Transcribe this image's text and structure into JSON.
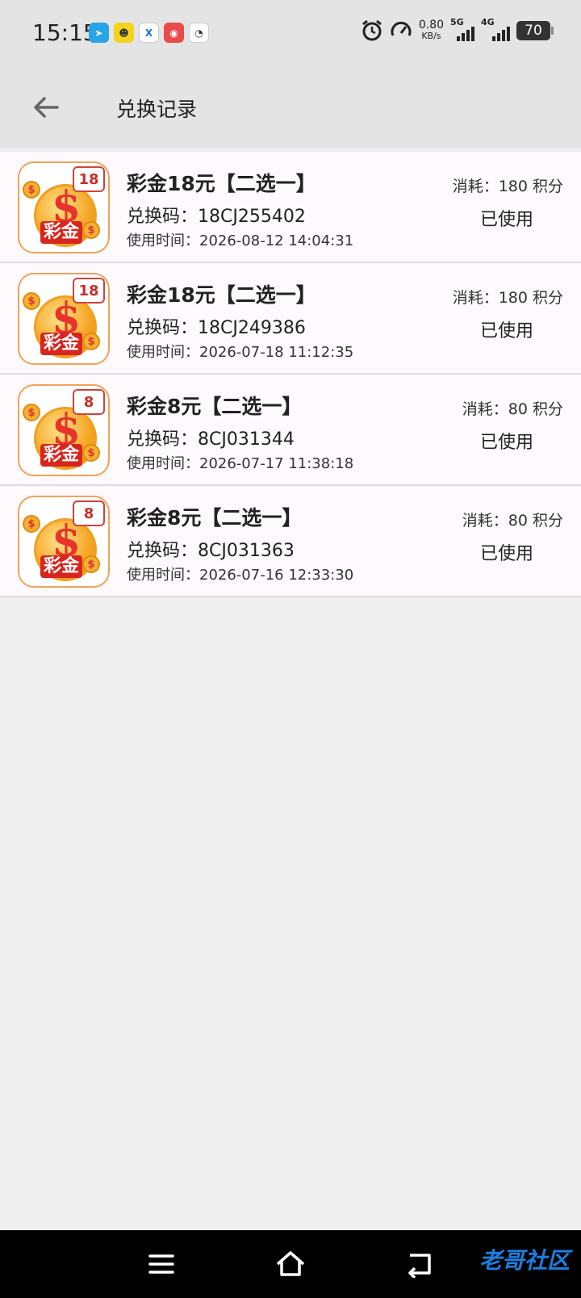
{
  "status_bar": {
    "time": "15:15",
    "speed_value": "0.80",
    "speed_unit": "KB/s",
    "network_1": "5G",
    "network_2": "4G",
    "battery": "70"
  },
  "header": {
    "title": "兑换记录"
  },
  "records": [
    {
      "tag": "18",
      "title": "彩金18元【二选一】",
      "code": "兑换码：18CJ255402",
      "time": "使用时间：2026-08-12 14:04:31",
      "cost": "消耗：180 积分",
      "status": "已使用"
    },
    {
      "tag": "18",
      "title": "彩金18元【二选一】",
      "code": "兑换码：18CJ249386",
      "time": "使用时间：2026-07-18 11:12:35",
      "cost": "消耗：180 积分",
      "status": "已使用"
    },
    {
      "tag": "8",
      "title": "彩金8元【二选一】",
      "code": "兑换码：8CJ031344",
      "time": "使用时间：2026-07-17 11:38:18",
      "cost": "消耗：80 积分",
      "status": "已使用"
    },
    {
      "tag": "8",
      "title": "彩金8元【二选一】",
      "code": "兑换码：8CJ031363",
      "time": "使用时间：2026-07-16 12:33:30",
      "cost": "消耗：80 积分",
      "status": "已使用"
    }
  ],
  "thumb_label": "彩金",
  "watermark": "老哥社区",
  "colors": {
    "accent_red": "#d8251e",
    "coin_gold": "#f5a623",
    "watermark_blue": "#1b7fe0"
  }
}
